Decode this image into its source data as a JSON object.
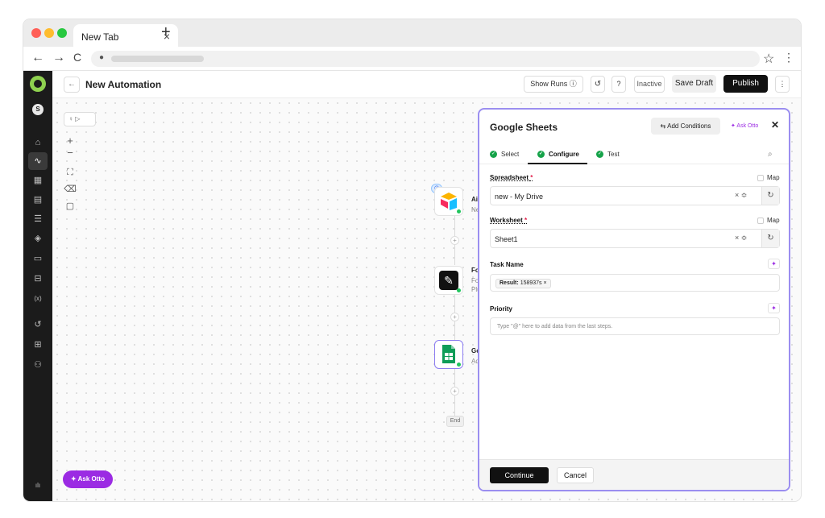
{
  "browser": {
    "tab_title": "New Tab",
    "tab_close": "×",
    "new_tab": "+",
    "back": "←",
    "forward": "→",
    "reload": "C",
    "lock": "🔒",
    "star": "☆",
    "menu": "⋮",
    "traffic_colors": [
      "#ff5f57",
      "#febc2e",
      "#28c840"
    ]
  },
  "sidebar": {
    "avatar_initial": "S",
    "items": [
      {
        "icon": "home-icon",
        "glyph": "⌂"
      },
      {
        "icon": "automation-icon",
        "glyph": "∿",
        "active": true
      },
      {
        "icon": "table-icon",
        "glyph": "▦"
      },
      {
        "icon": "document-icon",
        "glyph": "▤"
      },
      {
        "icon": "server-icon",
        "glyph": "☰"
      },
      {
        "icon": "layers-icon",
        "glyph": "◈"
      },
      {
        "icon": "folder-icon",
        "glyph": "▭"
      },
      {
        "icon": "inbox-icon",
        "glyph": "⊟"
      },
      {
        "icon": "variables-icon",
        "glyph": "(x)"
      },
      {
        "icon": "history-icon",
        "glyph": "↺"
      },
      {
        "icon": "apps-icon",
        "glyph": "⊞"
      },
      {
        "icon": "users-icon",
        "glyph": "⚇"
      }
    ],
    "bottom_icon": "ılı"
  },
  "header": {
    "back_glyph": "←",
    "title": "New Automation",
    "show_runs": "Show Runs ⓘ",
    "history_glyph": "↺",
    "help_glyph": "?",
    "status": "Inactive",
    "save_draft": "Save Draft",
    "publish": "Publish",
    "more_glyph": "⋮"
  },
  "canvas": {
    "zoom_in": "+",
    "zoom_out": "−",
    "fit_glyph": "⛶",
    "erase_glyph": "⌫",
    "note_glyph": "▢",
    "toggle_label": "♀ ▷",
    "nodes": [
      {
        "title": "AirTable",
        "subtitle": "New Reco"
      },
      {
        "title": "Formatter",
        "subtitle": "Format the",
        "subtitle2": "Pluralize"
      },
      {
        "title": "Google Sh",
        "subtitle": "Add New"
      }
    ],
    "plus": "+",
    "end_label": "End",
    "ask_otto": "✦ Ask Otto"
  },
  "panel": {
    "title": "Google Sheets",
    "add_conditions": "⇆ Add Conditions",
    "ask_otto": "✦ Ask Otto",
    "close": "✕",
    "tabs": [
      {
        "label": "Select"
      },
      {
        "label": "Configure",
        "active": true
      },
      {
        "label": "Test"
      }
    ],
    "check": "✓",
    "search_glyph": "⌕",
    "spreadsheet_label": "Spreadsheet",
    "worksheet_label": "Worksheet",
    "required_mark": "*",
    "map_label": "Map",
    "spreadsheet_value": "new - My Drive",
    "worksheet_value": "Sheet1",
    "select_controls": "× ≎",
    "refresh_glyph": "↻",
    "task_name_label": "Task Name",
    "task_chip_key": "Result:",
    "task_chip_value": "158937s",
    "chip_close": "×",
    "priority_label": "Priority",
    "priority_placeholder": "Type \"@\" here to add data from the last steps.",
    "sparkle_glyph": "✦",
    "continue": "Continue",
    "cancel": "Cancel"
  }
}
